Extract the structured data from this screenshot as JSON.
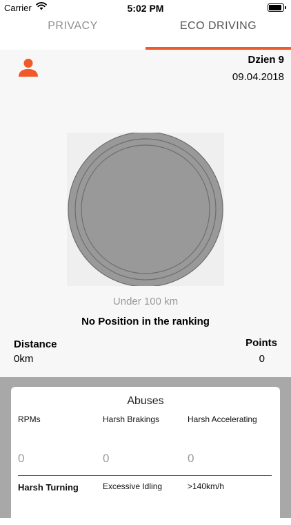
{
  "status_bar": {
    "carrier": "Carrier",
    "time": "5:02 PM"
  },
  "tabs": [
    {
      "label": "PRIVACY",
      "selected": false
    },
    {
      "label": "ECO DRIVING",
      "selected": true
    }
  ],
  "accent_color": "#f05a28",
  "header": {
    "day": "Dzien 9",
    "date": "09.04.2018"
  },
  "ranking": {
    "range_label": "Under 100 km",
    "position_label": "No Position in the ranking"
  },
  "stats": {
    "distance_label": "Distance",
    "distance_value": "0km",
    "points_label": "Points",
    "points_value": "0"
  },
  "abuses": {
    "title": "Abuses",
    "row1": [
      {
        "label": "RPMs",
        "value": "0"
      },
      {
        "label": "Harsh Brakings",
        "value": "0"
      },
      {
        "label": "Harsh Accelerating",
        "value": "0"
      }
    ],
    "row2": [
      {
        "label": "Harsh Turning"
      },
      {
        "label": "Excessive Idling"
      },
      {
        "label": ">140km/h"
      }
    ]
  }
}
